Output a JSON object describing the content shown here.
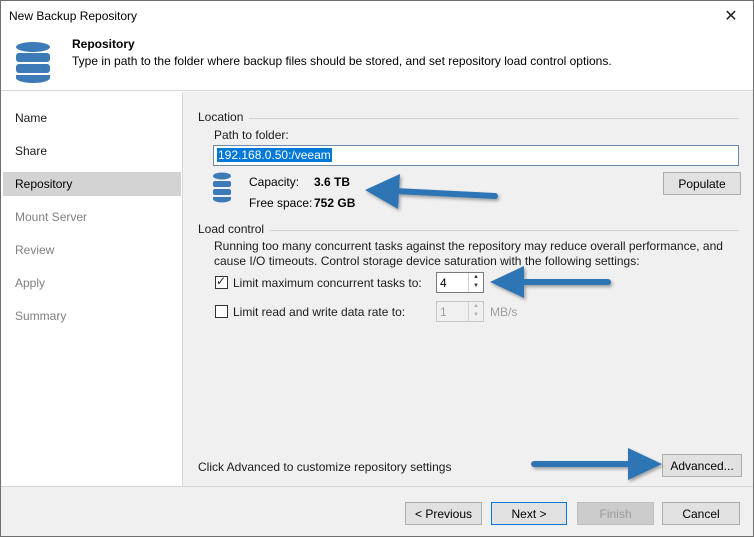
{
  "window": {
    "title": "New Backup Repository"
  },
  "header": {
    "title": "Repository",
    "description": "Type in path to the folder where backup files should be stored, and set repository load control options."
  },
  "sidebar": {
    "items": [
      {
        "label": "Name",
        "state": "normal"
      },
      {
        "label": "Share",
        "state": "normal"
      },
      {
        "label": "Repository",
        "state": "selected"
      },
      {
        "label": "Mount Server",
        "state": "disabled"
      },
      {
        "label": "Review",
        "state": "disabled"
      },
      {
        "label": "Apply",
        "state": "disabled"
      },
      {
        "label": "Summary",
        "state": "disabled"
      }
    ]
  },
  "location": {
    "section_label": "Location",
    "path_label": "Path to folder:",
    "path_value": "192.168.0.50:/veeam",
    "populate_label": "Populate",
    "capacity_label": "Capacity:",
    "capacity_value": "3.6 TB",
    "free_label": "Free space:",
    "free_value": "752 GB"
  },
  "load_control": {
    "section_label": "Load control",
    "description_line1": "Running too many concurrent tasks against the repository may reduce overall performance, and",
    "description_line2": "cause I/O timeouts. Control storage device saturation with the following settings:",
    "limit_tasks_label": "Limit maximum concurrent tasks to:",
    "limit_tasks_checked": true,
    "limit_tasks_value": "4",
    "limit_rate_label": "Limit read and write data rate to:",
    "limit_rate_checked": false,
    "limit_rate_value": "1",
    "limit_rate_unit": "MB/s"
  },
  "advanced": {
    "hint": "Click Advanced to customize repository settings",
    "button_label": "Advanced..."
  },
  "footer": {
    "previous_label": "< Previous",
    "next_label": "Next >",
    "finish_label": "Finish",
    "cancel_label": "Cancel"
  },
  "colors": {
    "accent": "#0078d7",
    "annotation_arrow": "#2e75b6",
    "db_icon": "#3d7ab8"
  }
}
